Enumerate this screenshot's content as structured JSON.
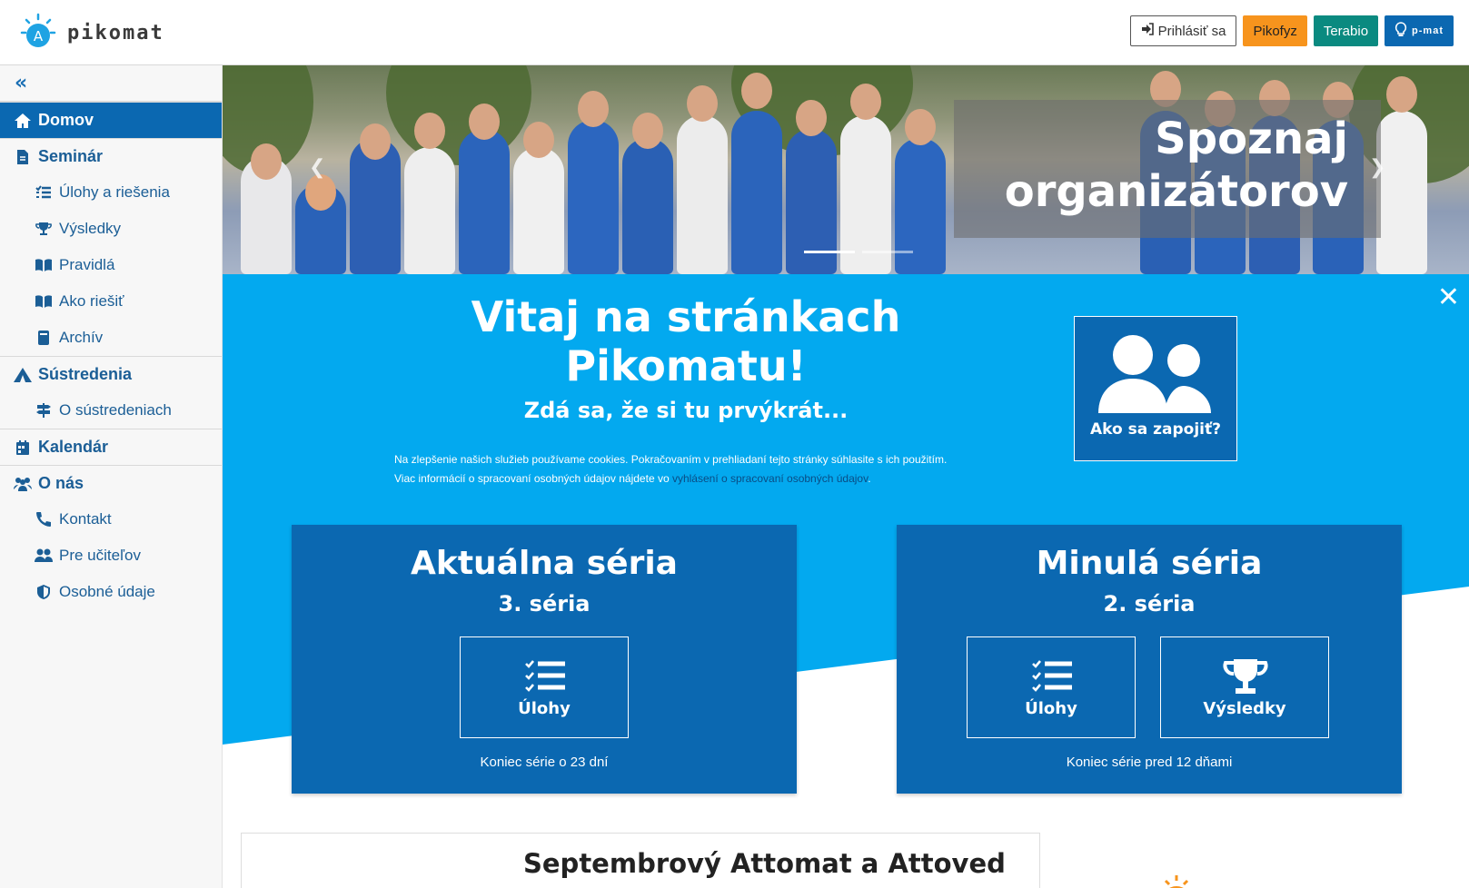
{
  "header": {
    "logo_text": "pikomat",
    "login_label": "Prihlásiť sa",
    "pikofyz_label": "Pikofyz",
    "terabio_label": "Terabio",
    "pmat_label": "p-mat",
    "colors": {
      "pikofyz": "#f7941d",
      "terabio": "#0a8a80",
      "pmat": "#0b68b1"
    }
  },
  "sidebar": {
    "collapse_icon": "double-chevron-left-icon",
    "items": [
      {
        "label": "Domov",
        "icon": "home-icon",
        "level": "top",
        "active": true
      },
      {
        "label": "Seminár",
        "icon": "document-icon",
        "level": "top"
      },
      {
        "label": "Úlohy a riešenia",
        "icon": "tasks-icon",
        "level": "sub"
      },
      {
        "label": "Výsledky",
        "icon": "trophy-icon",
        "level": "sub"
      },
      {
        "label": "Pravidlá",
        "icon": "book-open-icon",
        "level": "sub"
      },
      {
        "label": "Ako riešiť",
        "icon": "book-open-icon",
        "level": "sub"
      },
      {
        "label": "Archív",
        "icon": "book-icon",
        "level": "sub"
      },
      {
        "label": "Sústredenia",
        "icon": "tent-icon",
        "level": "top"
      },
      {
        "label": "O sústredeniach",
        "icon": "signpost-icon",
        "level": "sub"
      },
      {
        "label": "Kalendár",
        "icon": "calendar-icon",
        "level": "top"
      },
      {
        "label": "O nás",
        "icon": "users-icon",
        "level": "top"
      },
      {
        "label": "Kontakt",
        "icon": "phone-icon",
        "level": "sub"
      },
      {
        "label": "Pre učiteľov",
        "icon": "users-icon",
        "level": "sub"
      },
      {
        "label": "Osobné údaje",
        "icon": "shield-icon",
        "level": "sub"
      }
    ]
  },
  "hero": {
    "caption_line1": "Spoznaj",
    "caption_line2": "organizátorov",
    "slides": 2,
    "active_slide": 1
  },
  "welcome": {
    "title_line1": "Vitaj na stránkach",
    "title_line2": "Pikomatu!",
    "subtitle": "Zdá sa, že si tu prvýkrát...",
    "cookie_line1": "Na zlepšenie našich služieb používame cookies. Pokračovaním v prehliadaní tejto stránky súhlasite s ich použitím.",
    "cookie_line2_prefix": "Viac informácií o spracovaní osobných údajov nájdete vo ",
    "cookie_link": "vyhlásení o spracovaní osobných údajov",
    "cookie_line2_suffix": ".",
    "join_label": "Ako sa zapojiť?"
  },
  "cards": {
    "current": {
      "title": "Aktuálna séria",
      "series": "3. séria",
      "tasks_label": "Úlohy",
      "footer": "Koniec série o 23 dní"
    },
    "previous": {
      "title": "Minulá séria",
      "series": "2. séria",
      "tasks_label": "Úlohy",
      "results_label": "Výsledky",
      "footer": "Koniec série pred 12 dňami"
    }
  },
  "news": {
    "title": "Septembrový Attomat a Attoved"
  }
}
